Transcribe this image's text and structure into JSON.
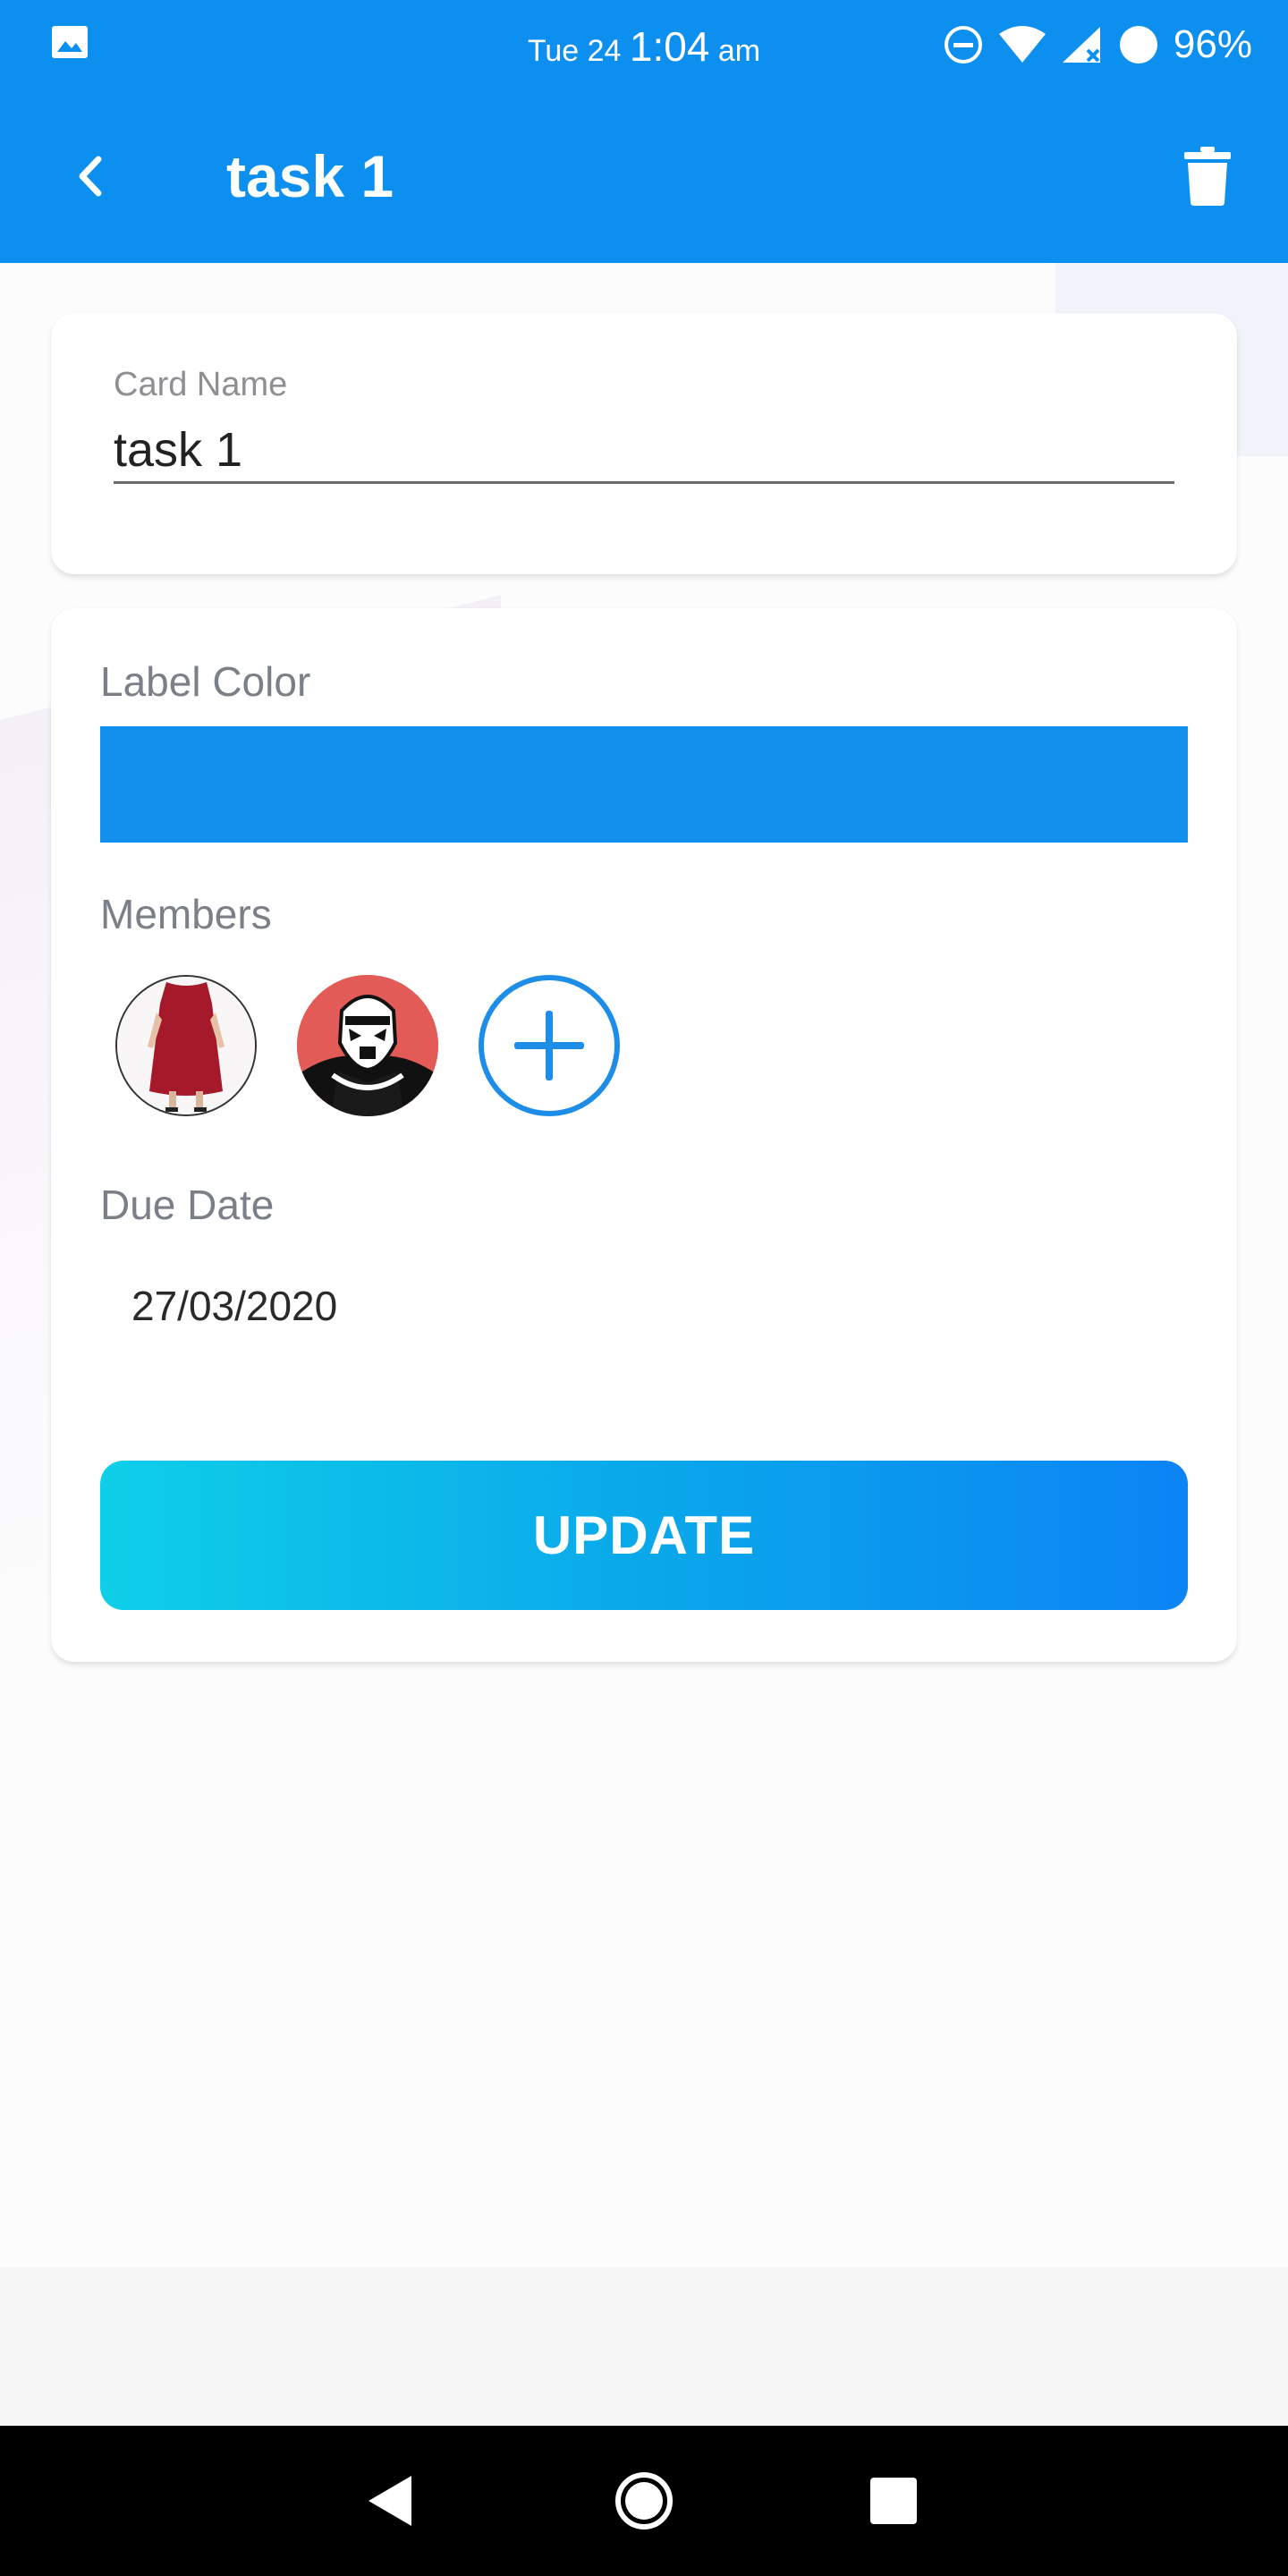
{
  "status_bar": {
    "day": "Tue 24",
    "time": "1:04",
    "ampm": "am",
    "battery": "96%"
  },
  "app_bar": {
    "title": "task 1"
  },
  "card_name": {
    "label": "Card Name",
    "value": "task 1"
  },
  "details": {
    "label_color_title": "Label Color",
    "label_color": "#1290EE",
    "members_title": "Members",
    "due_date_title": "Due Date",
    "due_date_value": "27/03/2020",
    "update_label": "UPDATE"
  },
  "colors": {
    "app_bar": "#0D8FF0",
    "accent": "#1E8DE8",
    "button_gradient_start": "#0ECFE8",
    "button_gradient_end": "#0B84F4"
  },
  "icons": {
    "status_left": "image-icon",
    "status_right": [
      "do-not-disturb-icon",
      "wifi-icon",
      "cell-signal-icon",
      "battery-icon"
    ],
    "app_bar_left": "back-arrow-icon",
    "app_bar_right": "trash-icon",
    "add_member": "plus-icon",
    "nav": [
      "back-triangle-icon",
      "home-circle-icon",
      "recents-square-icon"
    ]
  }
}
